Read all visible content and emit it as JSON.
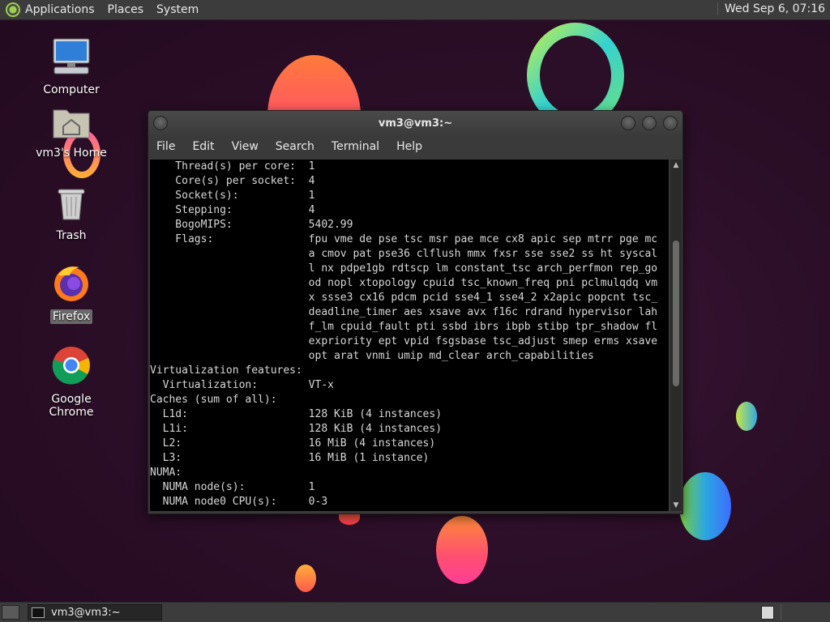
{
  "top_panel": {
    "menus": [
      "Applications",
      "Places",
      "System"
    ],
    "clock": "Wed Sep  6, 07:16"
  },
  "desktop_icons": [
    {
      "label": "Computer"
    },
    {
      "label": "vm3's Home"
    },
    {
      "label": "Trash"
    },
    {
      "label": "Firefox"
    },
    {
      "label": "Google Chrome"
    }
  ],
  "terminal": {
    "title": "vm3@vm3:~",
    "menu": [
      "File",
      "Edit",
      "View",
      "Search",
      "Terminal",
      "Help"
    ],
    "lines": [
      "    Thread(s) per core:  1",
      "    Core(s) per socket:  4",
      "    Socket(s):           1",
      "    Stepping:            4",
      "    BogoMIPS:            5402.99",
      "    Flags:               fpu vme de pse tsc msr pae mce cx8 apic sep mtrr pge mc",
      "                         a cmov pat pse36 clflush mmx fxsr sse sse2 ss ht syscal",
      "                         l nx pdpe1gb rdtscp lm constant_tsc arch_perfmon rep_go",
      "                         od nopl xtopology cpuid tsc_known_freq pni pclmulqdq vm",
      "                         x ssse3 cx16 pdcm pcid sse4_1 sse4_2 x2apic popcnt tsc_",
      "                         deadline_timer aes xsave avx f16c rdrand hypervisor lah",
      "                         f_lm cpuid_fault pti ssbd ibrs ibpb stibp tpr_shadow fl",
      "                         expriority ept vpid fsgsbase tsc_adjust smep erms xsave",
      "                         opt arat vnmi umip md_clear arch_capabilities",
      "Virtualization features:",
      "  Virtualization:        VT-x",
      "Caches (sum of all):",
      "  L1d:                   128 KiB (4 instances)",
      "  L1i:                   128 KiB (4 instances)",
      "  L2:                    16 MiB (4 instances)",
      "  L3:                    16 MiB (1 instance)",
      "NUMA:",
      "  NUMA node(s):          1",
      "  NUMA node0 CPU(s):     0-3"
    ]
  },
  "taskbar": {
    "task_label": "vm3@vm3:~"
  }
}
